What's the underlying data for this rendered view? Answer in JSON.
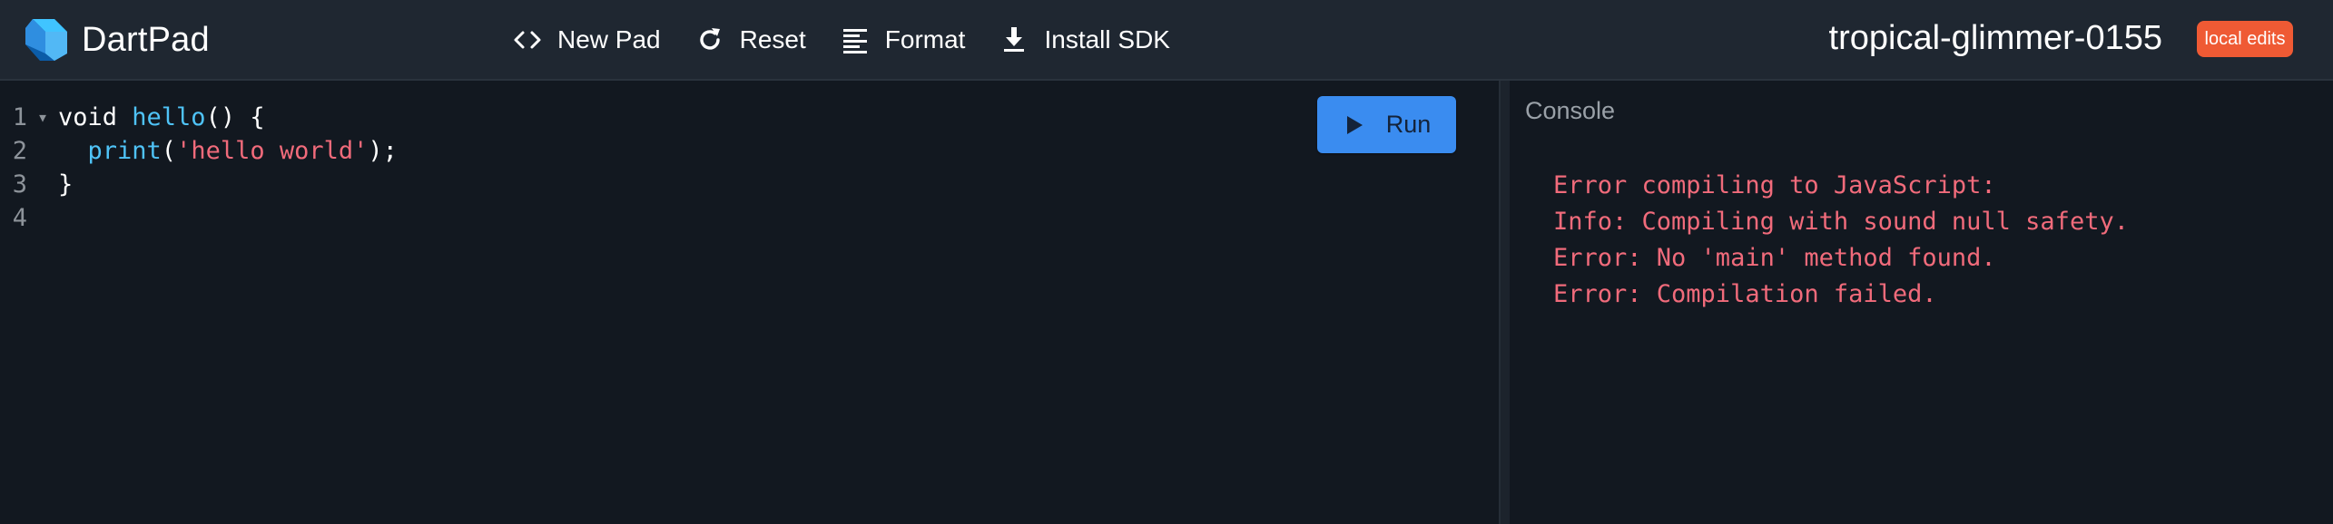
{
  "app": {
    "name": "DartPad"
  },
  "header": {
    "nav": [
      {
        "label": "New Pad",
        "icon": "code-brackets-icon"
      },
      {
        "label": "Reset",
        "icon": "refresh-icon"
      },
      {
        "label": "Format",
        "icon": "format-lines-icon"
      },
      {
        "label": "Install SDK",
        "icon": "download-icon"
      }
    ],
    "pad_title": "tropical-glimmer-0155",
    "badge": "local edits"
  },
  "editor": {
    "run_label": "Run",
    "lines": [
      {
        "number": "1",
        "fold": "▾",
        "tokens": [
          {
            "t": "void ",
            "c": "plain"
          },
          {
            "t": "hello",
            "c": "fn"
          },
          {
            "t": "() {",
            "c": "plain"
          }
        ]
      },
      {
        "number": "2",
        "fold": "",
        "tokens": [
          {
            "t": "  ",
            "c": "plain"
          },
          {
            "t": "print",
            "c": "fn"
          },
          {
            "t": "(",
            "c": "plain"
          },
          {
            "t": "'hello world'",
            "c": "str"
          },
          {
            "t": ");",
            "c": "plain"
          }
        ]
      },
      {
        "number": "3",
        "fold": "",
        "tokens": [
          {
            "t": "}",
            "c": "plain"
          }
        ]
      },
      {
        "number": "4",
        "fold": "",
        "tokens": []
      }
    ]
  },
  "console": {
    "title": "Console",
    "output": [
      "Error compiling to JavaScript:",
      "Info: Compiling with sound null safety.",
      "Error: No 'main' method found.",
      "Error: Compilation failed."
    ]
  },
  "colors": {
    "header_bg": "#1f2731",
    "editor_bg": "#121820",
    "accent_blue": "#3a8cf0",
    "badge_orange": "#ef5a34",
    "string_red": "#f16b7b",
    "function_cyan": "#4fc3f7"
  }
}
